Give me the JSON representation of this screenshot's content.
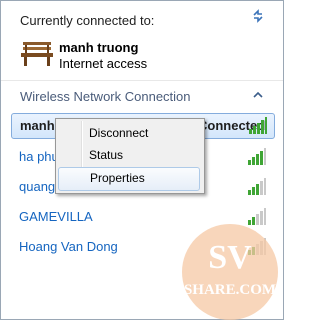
{
  "header": {
    "title": "Currently connected to:",
    "connection_name": "manh truong",
    "connection_status": "Internet access"
  },
  "section": {
    "label": "Wireless Network Connection"
  },
  "networks": [
    {
      "name": "manh truong",
      "status": "Connected",
      "selected": true
    },
    {
      "name": "ha phuong"
    },
    {
      "name": "quang huy"
    },
    {
      "name": "GAMEVILLA"
    },
    {
      "name": "Hoang Van Dong"
    }
  ],
  "context_menu": {
    "items": [
      "Disconnect",
      "Status",
      "Properties"
    ],
    "hovered": "Properties"
  },
  "watermark": {
    "top": "SV",
    "bottom": "SHARE.COM"
  },
  "colors": {
    "link": "#1565c0",
    "section_label": "#4a5c7a",
    "selection_border": "#84acdd",
    "signal_green": "#3fa535"
  }
}
